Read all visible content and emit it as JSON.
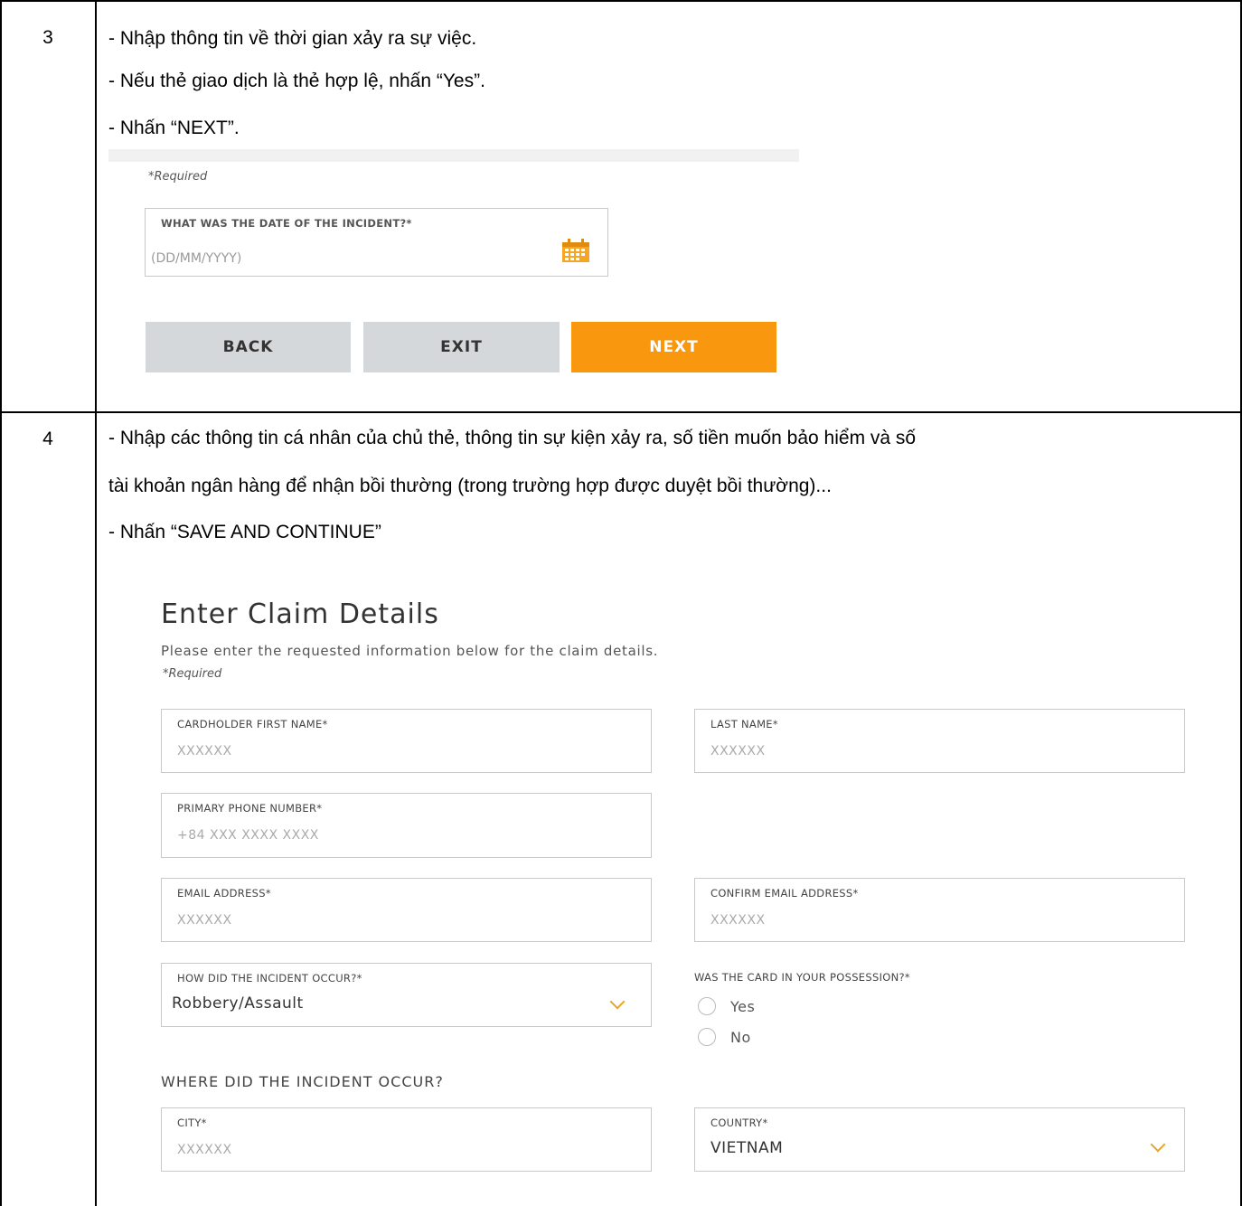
{
  "step3": {
    "number": "3",
    "lines": [
      "- Nhập thông tin về thời gian xảy ra sự việc.",
      "- Nếu thẻ giao dịch là thẻ hợp lệ, nhấn “Yes”.",
      "- Nhấn “NEXT”."
    ],
    "screenshot": {
      "required_note": "*Required",
      "date_field": {
        "label": "WHAT WAS THE DATE OF THE INCIDENT?*",
        "placeholder": "(DD/MM/YYYY)",
        "icon": "calendar-icon"
      },
      "buttons": {
        "back": "BACK",
        "exit": "EXIT",
        "next": "NEXT"
      },
      "accent_color": "#f9970f"
    }
  },
  "step4": {
    "number": "4",
    "lines": [
      "- Nhập các thông tin cá nhân của chủ thẻ, thông tin sự kiện xảy ra, số tiền muốn bảo hiểm và số",
      "tài khoản ngân hàng để nhận bồi thường (trong trường hợp được duyệt bồi thường)...",
      "- Nhấn “SAVE AND CONTINUE”"
    ],
    "form": {
      "title": "Enter Claim Details",
      "subtitle": "Please enter the requested information below for the claim details.",
      "required_note": "*Required",
      "first_name": {
        "label": "CARDHOLDER FIRST NAME*",
        "value": "XXXXXX"
      },
      "last_name": {
        "label": "LAST NAME*",
        "value": "XXXXXX"
      },
      "phone": {
        "label": "PRIMARY PHONE NUMBER*",
        "value": "+84 XXX XXXX XXXX"
      },
      "email": {
        "label": "EMAIL ADDRESS*",
        "value": "XXXXXX"
      },
      "confirm_email": {
        "label": "CONFIRM EMAIL ADDRESS*",
        "value": "XXXXXX"
      },
      "incident_how": {
        "label": "HOW DID THE INCIDENT OCCUR?*",
        "value": "Robbery/Assault"
      },
      "possession": {
        "label": "WAS THE CARD IN YOUR POSSESSION?*",
        "options": [
          "Yes",
          "No"
        ]
      },
      "where_heading": "WHERE DID THE INCIDENT OCCUR?",
      "city": {
        "label": "CITY*",
        "value": "XXXXXX"
      },
      "country": {
        "label": "COUNTRY*",
        "value": "VIETNAM"
      }
    }
  }
}
